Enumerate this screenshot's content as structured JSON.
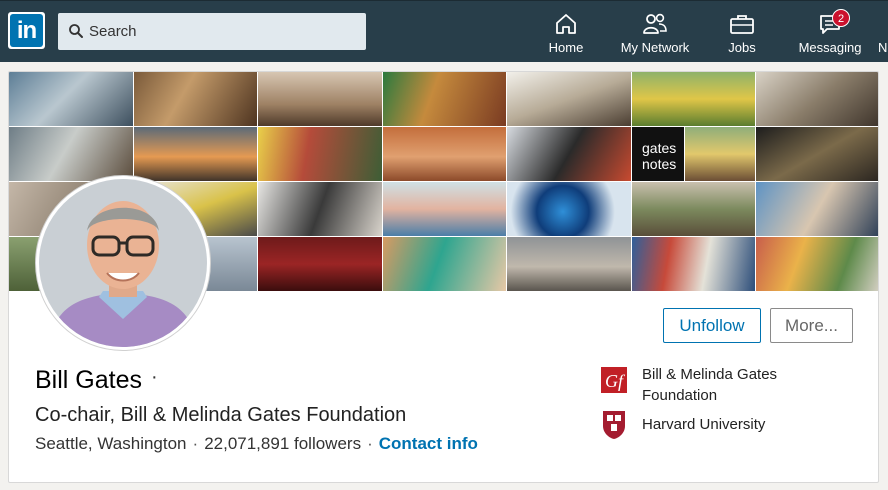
{
  "nav": {
    "logo_text": "in",
    "search_placeholder": "Search",
    "items": [
      {
        "label": "Home",
        "icon": "home-icon"
      },
      {
        "label": "My Network",
        "icon": "people-icon"
      },
      {
        "label": "Jobs",
        "icon": "briefcase-icon"
      },
      {
        "label": "Messaging",
        "icon": "chat-icon",
        "badge": "2"
      }
    ],
    "overflow_letter": "N"
  },
  "cover": {
    "tile_caption": "gates\nnotes"
  },
  "profile": {
    "name": "Bill Gates",
    "name_separator": "·",
    "headline": "Co-chair, Bill & Melinda Gates Foundation",
    "location": "Seattle, Washington",
    "followers": "22,071,891 followers",
    "separator": "·",
    "contact_link": "Contact info",
    "unfollow_label": "Unfollow",
    "more_label": "More..."
  },
  "organizations": [
    {
      "name_line1": "Bill & Melinda Gates",
      "name_line2": "Foundation",
      "logo": "gates-foundation-logo"
    },
    {
      "name_line1": "Harvard University",
      "name_line2": "",
      "logo": "harvard-shield-logo"
    }
  ],
  "colors": {
    "nav_bg": "#283e4a",
    "brand_blue": "#0073b1",
    "badge_red": "#cb112d"
  }
}
